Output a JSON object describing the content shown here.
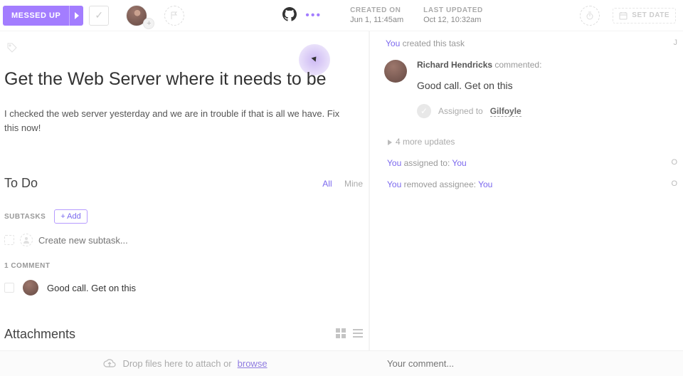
{
  "topbar": {
    "status_label": "MESSED UP",
    "created_on_label": "CREATED ON",
    "created_on_value": "Jun 1, 11:45am",
    "last_updated_label": "LAST UPDATED",
    "last_updated_value": "Oct 12, 10:32am",
    "set_date_label": "SET DATE"
  },
  "task": {
    "title": "Get the Web Server where it needs to be",
    "description": "I checked the web server yesterday and we are in trouble if that is all we have. Fix this now!"
  },
  "todo": {
    "heading": "To Do",
    "tab_all": "All",
    "tab_mine": "Mine",
    "subtasks_label": "SUBTASKS",
    "add_label": "+ Add",
    "new_placeholder": "Create new subtask...",
    "comments_count_label": "1 COMMENT",
    "comment_0": "Good call. Get on this"
  },
  "attachments": {
    "heading": "Attachments",
    "drop_text_prefix": "Drop files here to attach or ",
    "browse_label": "browse"
  },
  "activity": {
    "you": "You",
    "created_suffix": " created this task",
    "edge_j": "J",
    "commenter": "Richard Hendricks",
    "commented_word": " commented:",
    "comment_body": "Good call. Get on this",
    "assigned_to_label": "Assigned to ",
    "assignee": "Gilfoyle",
    "more_updates": "4 more updates",
    "assigned_to_you_label": " assigned to: ",
    "you_target": "You",
    "edge_o1": "O",
    "removed_label": " removed assignee: ",
    "edge_o2": "O"
  },
  "footer": {
    "comment_placeholder": "Your comment..."
  }
}
